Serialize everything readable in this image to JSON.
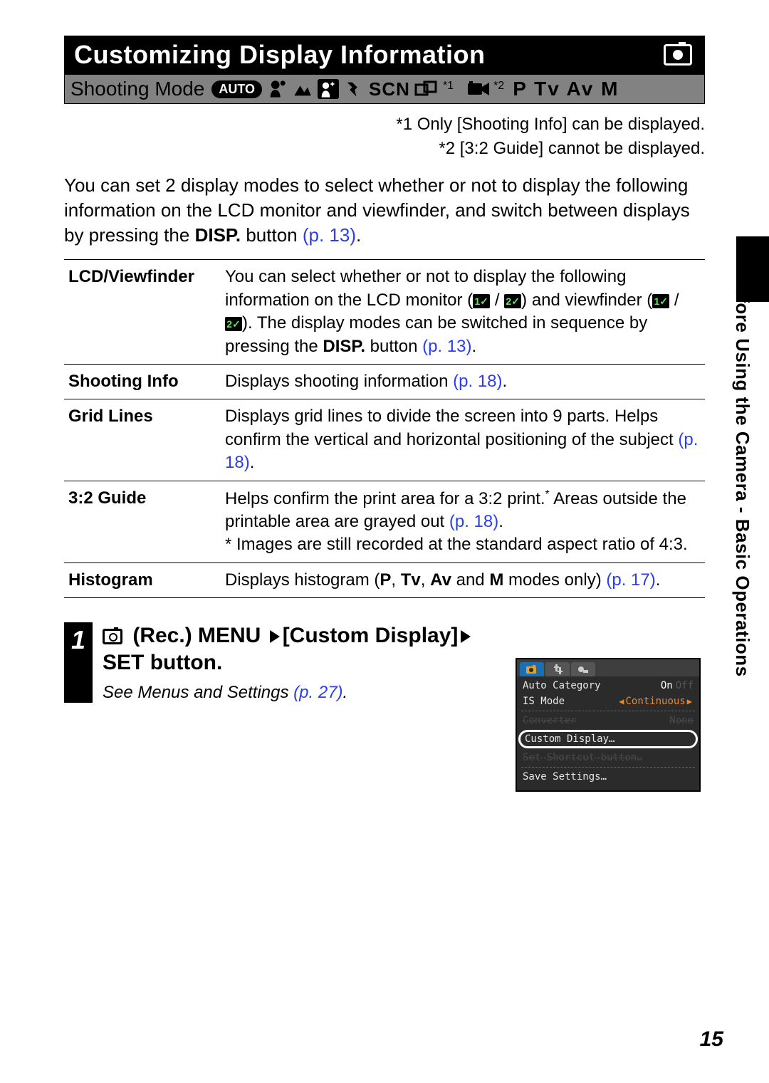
{
  "title": "Customizing Display Information",
  "shooting_mode_label": "Shooting Mode",
  "mode_auto": "AUTO",
  "mode_scn": "SCN",
  "mode_ptvavm": "P Tv Av M",
  "sup1": "*1",
  "sup2": "*2",
  "footnote1": "*1 Only [Shooting Info] can be displayed.",
  "footnote2": "*2 [3:2 Guide] cannot be displayed.",
  "intro_a": "You can set 2 display modes to select whether or not to display the following information on the LCD monitor and viewfinder, and switch between displays by pressing the ",
  "intro_b_bold": "DISP.",
  "intro_c": " button ",
  "intro_link": "(p. 13)",
  "intro_d": ".",
  "table": {
    "r1_h": "LCD/Viewfinder",
    "r1_a": "You can select whether or not to display the following information on the LCD monitor (",
    "r1_b": ") and viewfinder (",
    "r1_c": "). The display modes can be switched in sequence by pressing the ",
    "r1_d_bold": "DISP.",
    "r1_e": " button ",
    "r1_link": "(p. 13)",
    "r1_f": ".",
    "r2_h": "Shooting Info",
    "r2_a": "Displays shooting information ",
    "r2_link": "(p. 18)",
    "r2_b": ".",
    "r3_h": "Grid Lines",
    "r3_a": "Displays grid lines to divide the screen into 9 parts. Helps confirm the vertical and horizontal positioning of the subject ",
    "r3_link": "(p. 18)",
    "r3_b": ".",
    "r4_h": "3:2 Guide",
    "r4_a": "Helps confirm the print area for a 3:2 print.",
    "r4_ast": "*",
    "r4_b": " Areas outside the printable area are grayed out ",
    "r4_link": "(p. 18)",
    "r4_c": ".",
    "r4_note": "* Images are still recorded at the standard aspect ratio of 4:3.",
    "r5_h": "Histogram",
    "r5_a": "Displays histogram (",
    "r5_p": "P",
    "r5_s1": ", ",
    "r5_tv": "Tv",
    "r5_s2": ", ",
    "r5_av": "Av",
    "r5_s3": " and ",
    "r5_m": "M",
    "r5_b": " modes only) ",
    "r5_link": "(p. 17)",
    "r5_c": "."
  },
  "step_num": "1",
  "step_instr_a": " (Rec.) MENU ",
  "step_instr_b": "[Custom Display]",
  "step_instr_c": "SET",
  "step_instr_d": " button.",
  "step_sub_a": "See Menus and Settings ",
  "step_sub_link": "(p. 27)",
  "step_sub_b": ".",
  "menu": {
    "r1_l": "Auto Category",
    "r1_on": "On",
    "r1_off": "Off",
    "r2_l": "IS Mode",
    "r2_v": "Continuous",
    "r3_l": "Converter",
    "r3_v": "None",
    "r4_l": "Custom Display…",
    "r5_l": "Set Shortcut button…",
    "r6_l": "Save Settings…"
  },
  "side_text": "Before Using the Camera - Basic Operations",
  "page_number": "15"
}
